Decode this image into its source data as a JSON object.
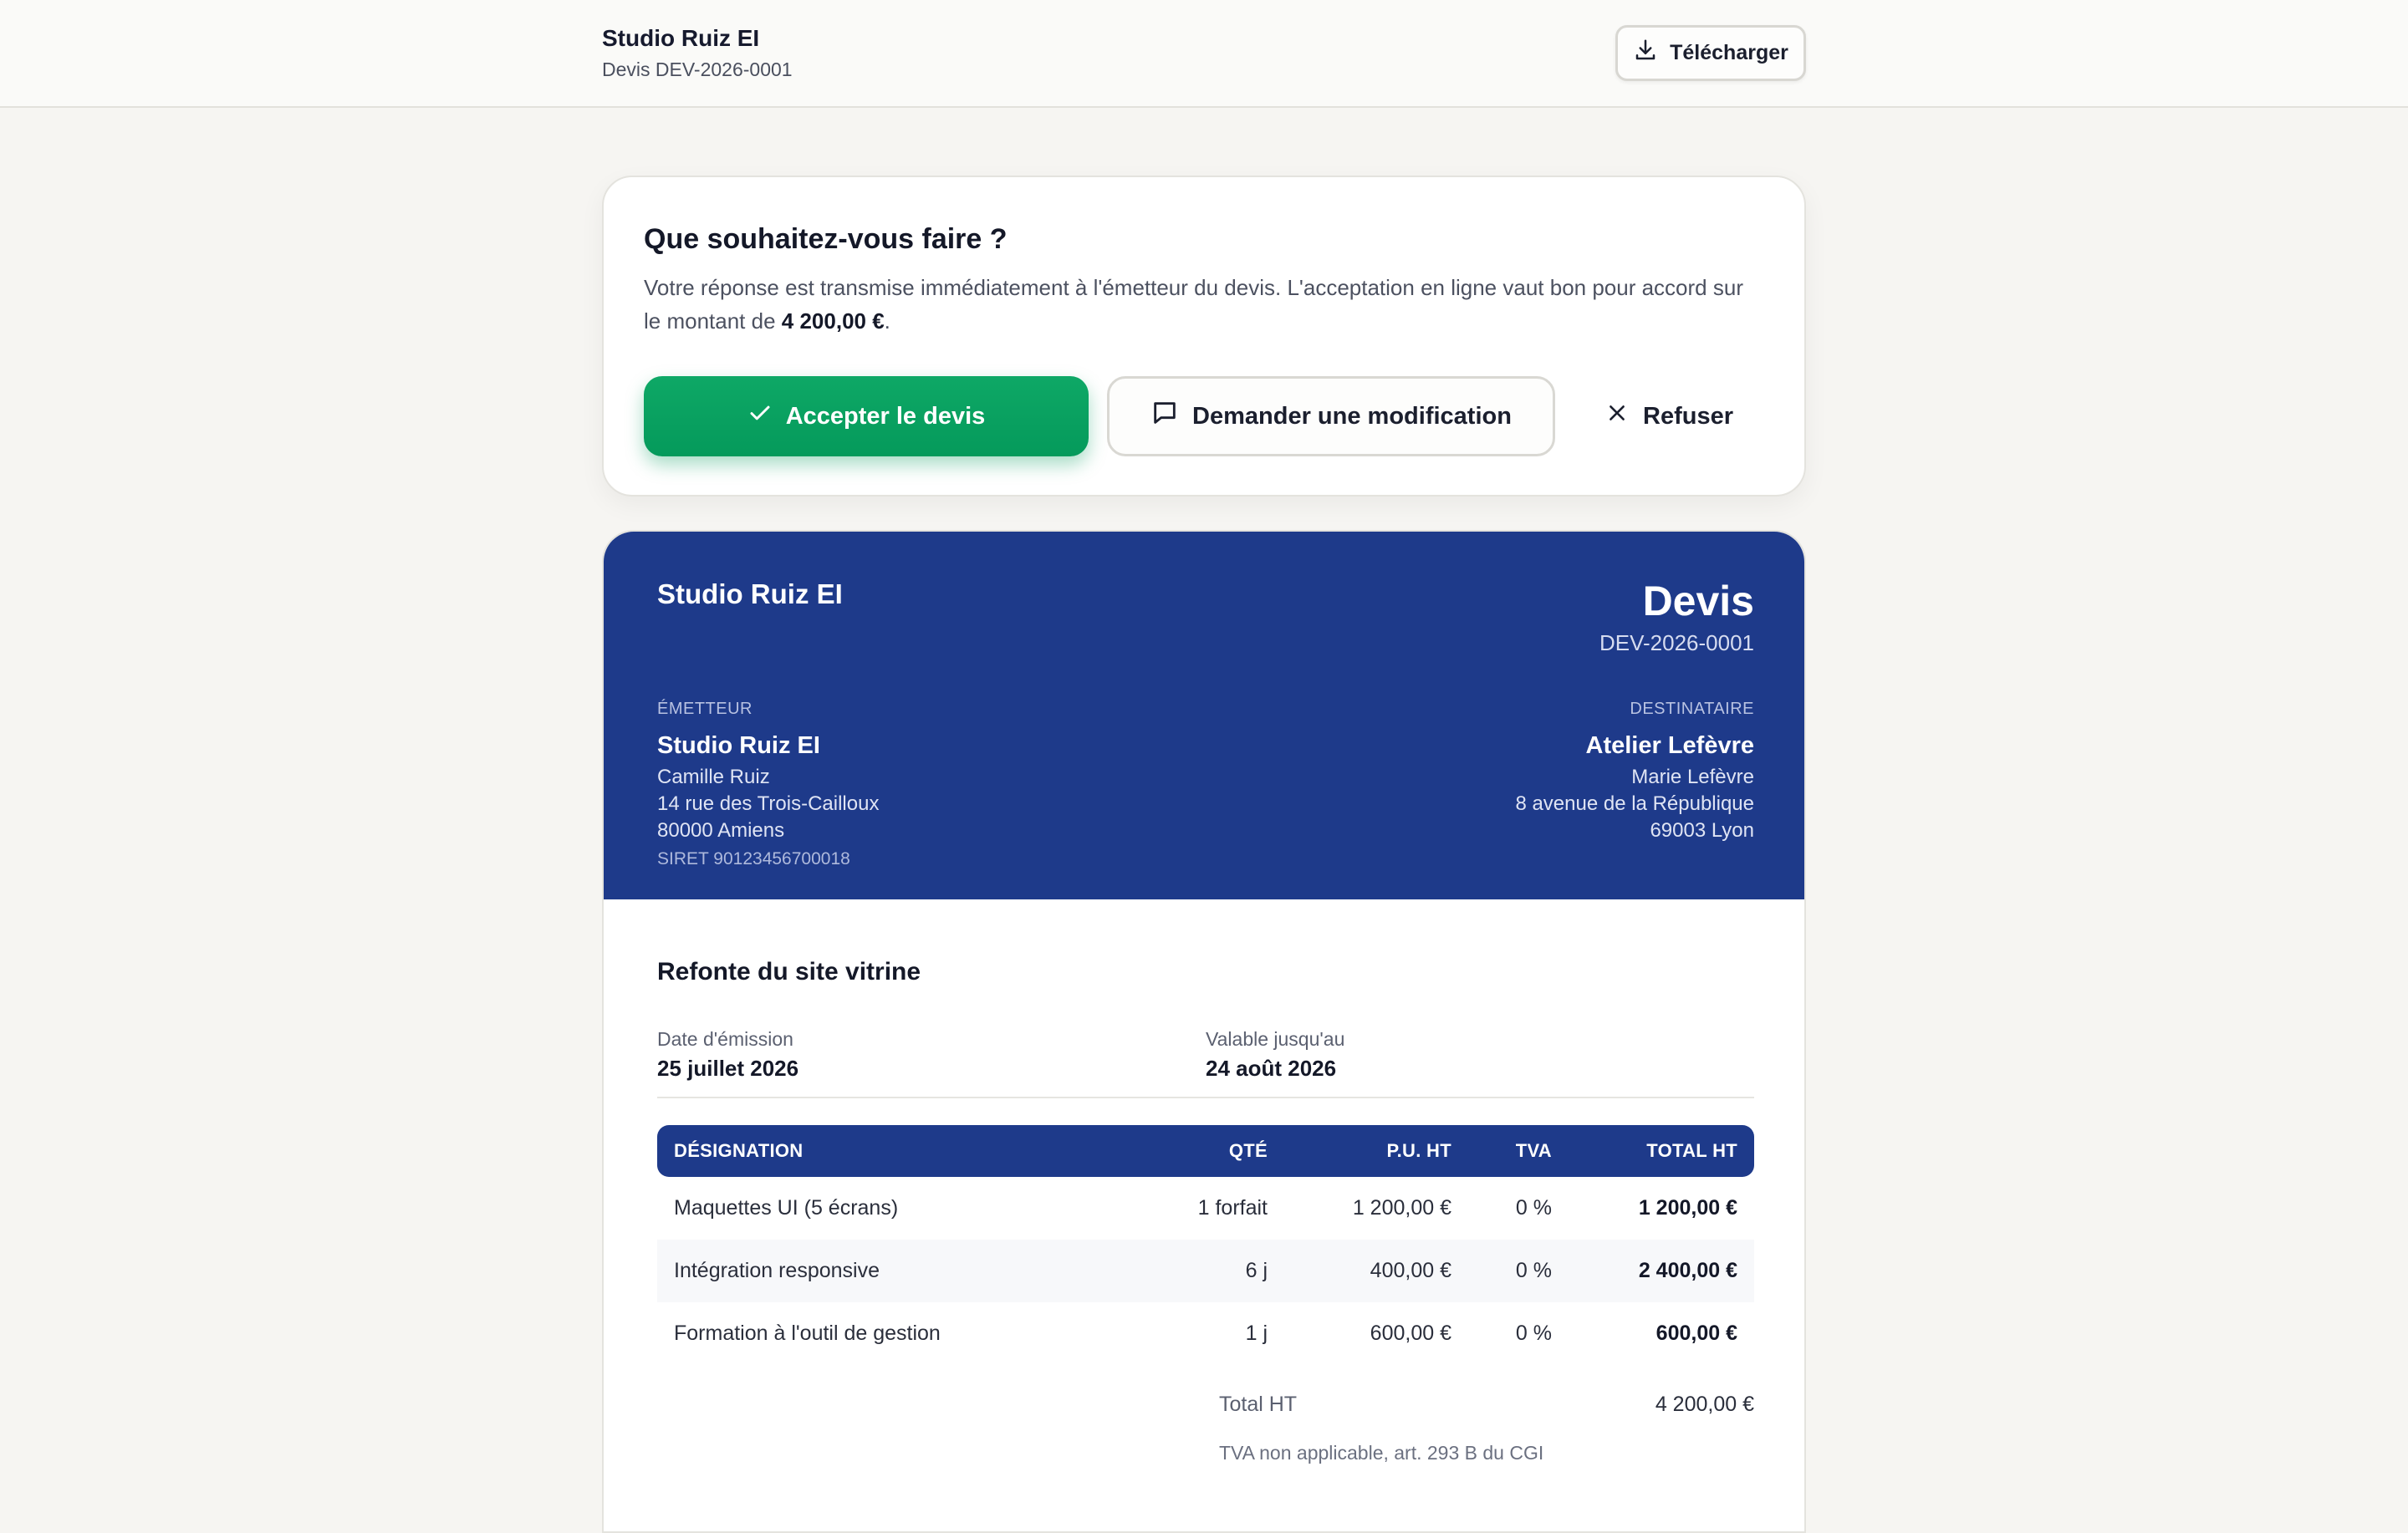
{
  "topbar": {
    "brand": "Studio Ruiz EI",
    "subtitle": "Devis DEV-2026-0001",
    "download_label": "Télécharger"
  },
  "action_card": {
    "title": "Que souhaitez-vous faire ?",
    "text_before": "Votre réponse est transmise immédiatement à l'émetteur du devis. L'acceptation en ligne vaut bon pour accord sur le montant de ",
    "amount": "4 200,00 €",
    "text_after": ".",
    "accept_label": "Accepter le devis",
    "modify_label": "Demander une modification",
    "refuse_label": "Refuser",
    "accent_color": "#059a5b"
  },
  "quote": {
    "brand": "Studio Ruiz EI",
    "doc_type": "Devis",
    "number": "DEV-2026-0001",
    "header_color": "#1e3a8a",
    "issuer": {
      "label": "ÉMETTEUR",
      "name": "Studio Ruiz EI",
      "contact": "Camille Ruiz",
      "address": "14 rue des Trois-Cailloux",
      "city": "80000 Amiens",
      "siret": "SIRET 90123456700018"
    },
    "recipient": {
      "label": "DESTINATAIRE",
      "name": "Atelier Lefèvre",
      "contact": "Marie Lefèvre",
      "address": "8 avenue de la République",
      "city": "69003 Lyon"
    },
    "subject": "Refonte du site vitrine",
    "issue_date_label": "Date d'émission",
    "issue_date": "25 juillet 2026",
    "valid_label": "Valable jusqu'au",
    "valid_date": "24 août 2026",
    "columns": {
      "designation": "DÉSIGNATION",
      "qty": "QTÉ",
      "unit_price": "P.U. HT",
      "tva": "TVA",
      "total": "TOTAL HT"
    },
    "items": [
      {
        "designation": "Maquettes UI (5 écrans)",
        "qty": "1 forfait",
        "unit_price": "1 200,00 €",
        "tva": "0 %",
        "total": "1 200,00 €"
      },
      {
        "designation": "Intégration responsive",
        "qty": "6 j",
        "unit_price": "400,00 €",
        "tva": "0 %",
        "total": "2 400,00 €"
      },
      {
        "designation": "Formation à l'outil de gestion",
        "qty": "1 j",
        "unit_price": "600,00 €",
        "tva": "0 %",
        "total": "600,00 €"
      }
    ],
    "total_ht_label": "Total HT",
    "total_ht": "4 200,00 €",
    "tva_note": "TVA non applicable, art. 293 B du CGI"
  }
}
